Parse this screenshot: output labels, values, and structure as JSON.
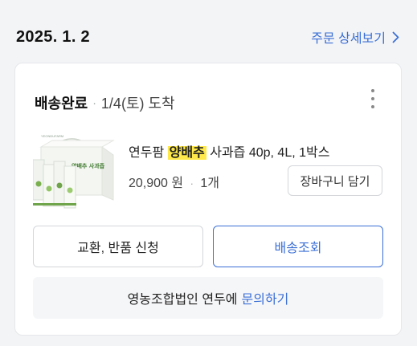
{
  "order_date": "2025. 1. 2",
  "detail_link_label": "주문 상세보기",
  "status": {
    "main": "배송완료",
    "dot": "·",
    "arrival": "1/4(토) 도착"
  },
  "product": {
    "name_prefix": "연두팜 ",
    "name_highlight": "양배추",
    "name_suffix": " 사과즙 40p, 4L, 1박스",
    "price": "20,900 원",
    "dot": "·",
    "quantity": "1개",
    "thumb_brand": "YEONDUFARM",
    "thumb_box_label": "양배추 사과즙"
  },
  "buttons": {
    "cart": "장바구니 담기",
    "exchange_return": "교환, 반품 신청",
    "track": "배송조회"
  },
  "seller": {
    "text": "영농조합법인 연두에",
    "inquiry": "문의하기"
  },
  "colors": {
    "accent": "#3b6fd6",
    "highlight": "#ffe94a",
    "package_green": "#6fa44a"
  }
}
